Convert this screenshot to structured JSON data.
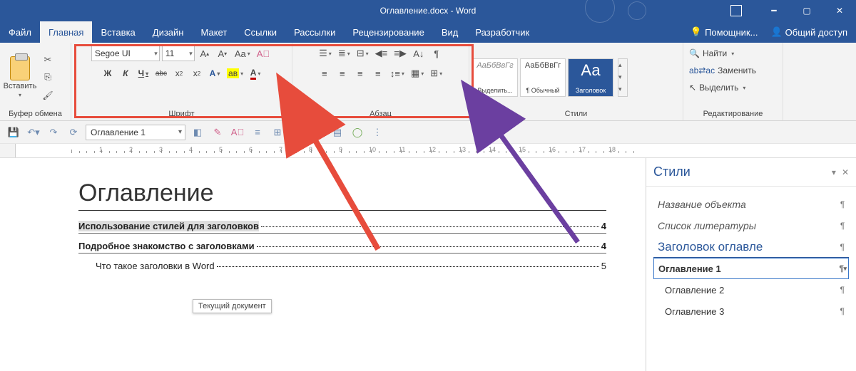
{
  "title": "Оглавление.docx - Word",
  "tabs": {
    "file": "Файл",
    "home": "Главная",
    "insert": "Вставка",
    "design": "Дизайн",
    "layout": "Макет",
    "refs": "Ссылки",
    "mailings": "Рассылки",
    "review": "Рецензирование",
    "view": "Вид",
    "developer": "Разработчик",
    "help": "Помощник...",
    "share": "Общий доступ"
  },
  "ribbon": {
    "clipboard": {
      "paste": "Вставить",
      "label": "Буфер обмена"
    },
    "font": {
      "name": "Segoe UI",
      "size": "11",
      "label": "Шрифт",
      "bold": "Ж",
      "italic": "К",
      "underline": "Ч",
      "strike": "abc",
      "incr": "A",
      "decr": "A",
      "case": "Aa",
      "color": "A",
      "hl": "aʙ"
    },
    "para": {
      "label": "Абзац"
    },
    "styles": {
      "label": "Стили",
      "select": "Выделить...",
      "normal": "¶ Обычный",
      "heading": "Заголовок",
      "preview": "АаБбВвГг",
      "previewHeading": "Аа"
    },
    "editing": {
      "find": "Найти",
      "replace": "Заменить",
      "select": "Выделить",
      "label": "Редактирование"
    }
  },
  "qat": {
    "style_selector": "Оглавление 1"
  },
  "doc": {
    "title": "Оглавление",
    "toc": [
      {
        "text": "Использование стилей для заголовков",
        "page": "4",
        "bold": true
      },
      {
        "text": "Подробное знакомство с заголовками",
        "page": "4",
        "bold": true
      },
      {
        "text": "Что такое заголовки в Word",
        "page": "5",
        "bold": false
      }
    ],
    "tooltip": "Текущий документ"
  },
  "styles_pane": {
    "title": "Стили",
    "items": [
      {
        "label": "Название объекта",
        "cls": "ital"
      },
      {
        "label": "Список литературы",
        "cls": "ital"
      },
      {
        "label": "Заголовок оглавле",
        "cls": "h1"
      },
      {
        "label": "Оглавление 1",
        "cls": "sel"
      },
      {
        "label": "Оглавление 2",
        "cls": "ind"
      },
      {
        "label": "Оглавление 3",
        "cls": "ind"
      }
    ]
  }
}
